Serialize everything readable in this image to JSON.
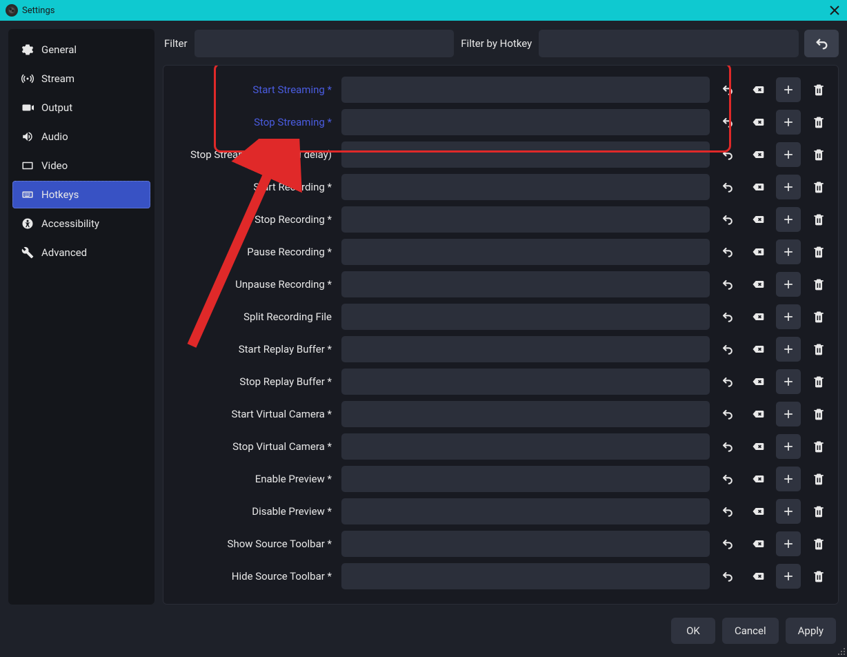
{
  "window": {
    "title": "Settings"
  },
  "sidebar": {
    "items": [
      {
        "id": "general",
        "label": "General"
      },
      {
        "id": "stream",
        "label": "Stream"
      },
      {
        "id": "output",
        "label": "Output"
      },
      {
        "id": "audio",
        "label": "Audio"
      },
      {
        "id": "video",
        "label": "Video"
      },
      {
        "id": "hotkeys",
        "label": "Hotkeys"
      },
      {
        "id": "accessibility",
        "label": "Accessibility"
      },
      {
        "id": "advanced",
        "label": "Advanced"
      }
    ],
    "selected": "hotkeys"
  },
  "filters": {
    "filter_label": "Filter",
    "filter_by_hotkey_label": "Filter by Hotkey",
    "filter_value": "",
    "filter_by_hotkey_value": ""
  },
  "hotkeys": [
    {
      "label": "Start Streaming *",
      "value": "",
      "highlight": true
    },
    {
      "label": "Stop Streaming *",
      "value": "",
      "highlight": true
    },
    {
      "label": "Stop Streaming (discard delay)",
      "value": "",
      "highlight": false
    },
    {
      "label": "Start Recording *",
      "value": "",
      "highlight": false
    },
    {
      "label": "Stop Recording *",
      "value": "",
      "highlight": false
    },
    {
      "label": "Pause Recording *",
      "value": "",
      "highlight": false
    },
    {
      "label": "Unpause Recording *",
      "value": "",
      "highlight": false
    },
    {
      "label": "Split Recording File",
      "value": "",
      "highlight": false
    },
    {
      "label": "Start Replay Buffer *",
      "value": "",
      "highlight": false
    },
    {
      "label": "Stop Replay Buffer *",
      "value": "",
      "highlight": false
    },
    {
      "label": "Start Virtual Camera *",
      "value": "",
      "highlight": false
    },
    {
      "label": "Stop Virtual Camera *",
      "value": "",
      "highlight": false
    },
    {
      "label": "Enable Preview *",
      "value": "",
      "highlight": false
    },
    {
      "label": "Disable Preview *",
      "value": "",
      "highlight": false
    },
    {
      "label": "Show Source Toolbar *",
      "value": "",
      "highlight": false
    },
    {
      "label": "Hide Source Toolbar *",
      "value": "",
      "highlight": false
    }
  ],
  "footer": {
    "ok": "OK",
    "cancel": "Cancel",
    "apply": "Apply"
  }
}
